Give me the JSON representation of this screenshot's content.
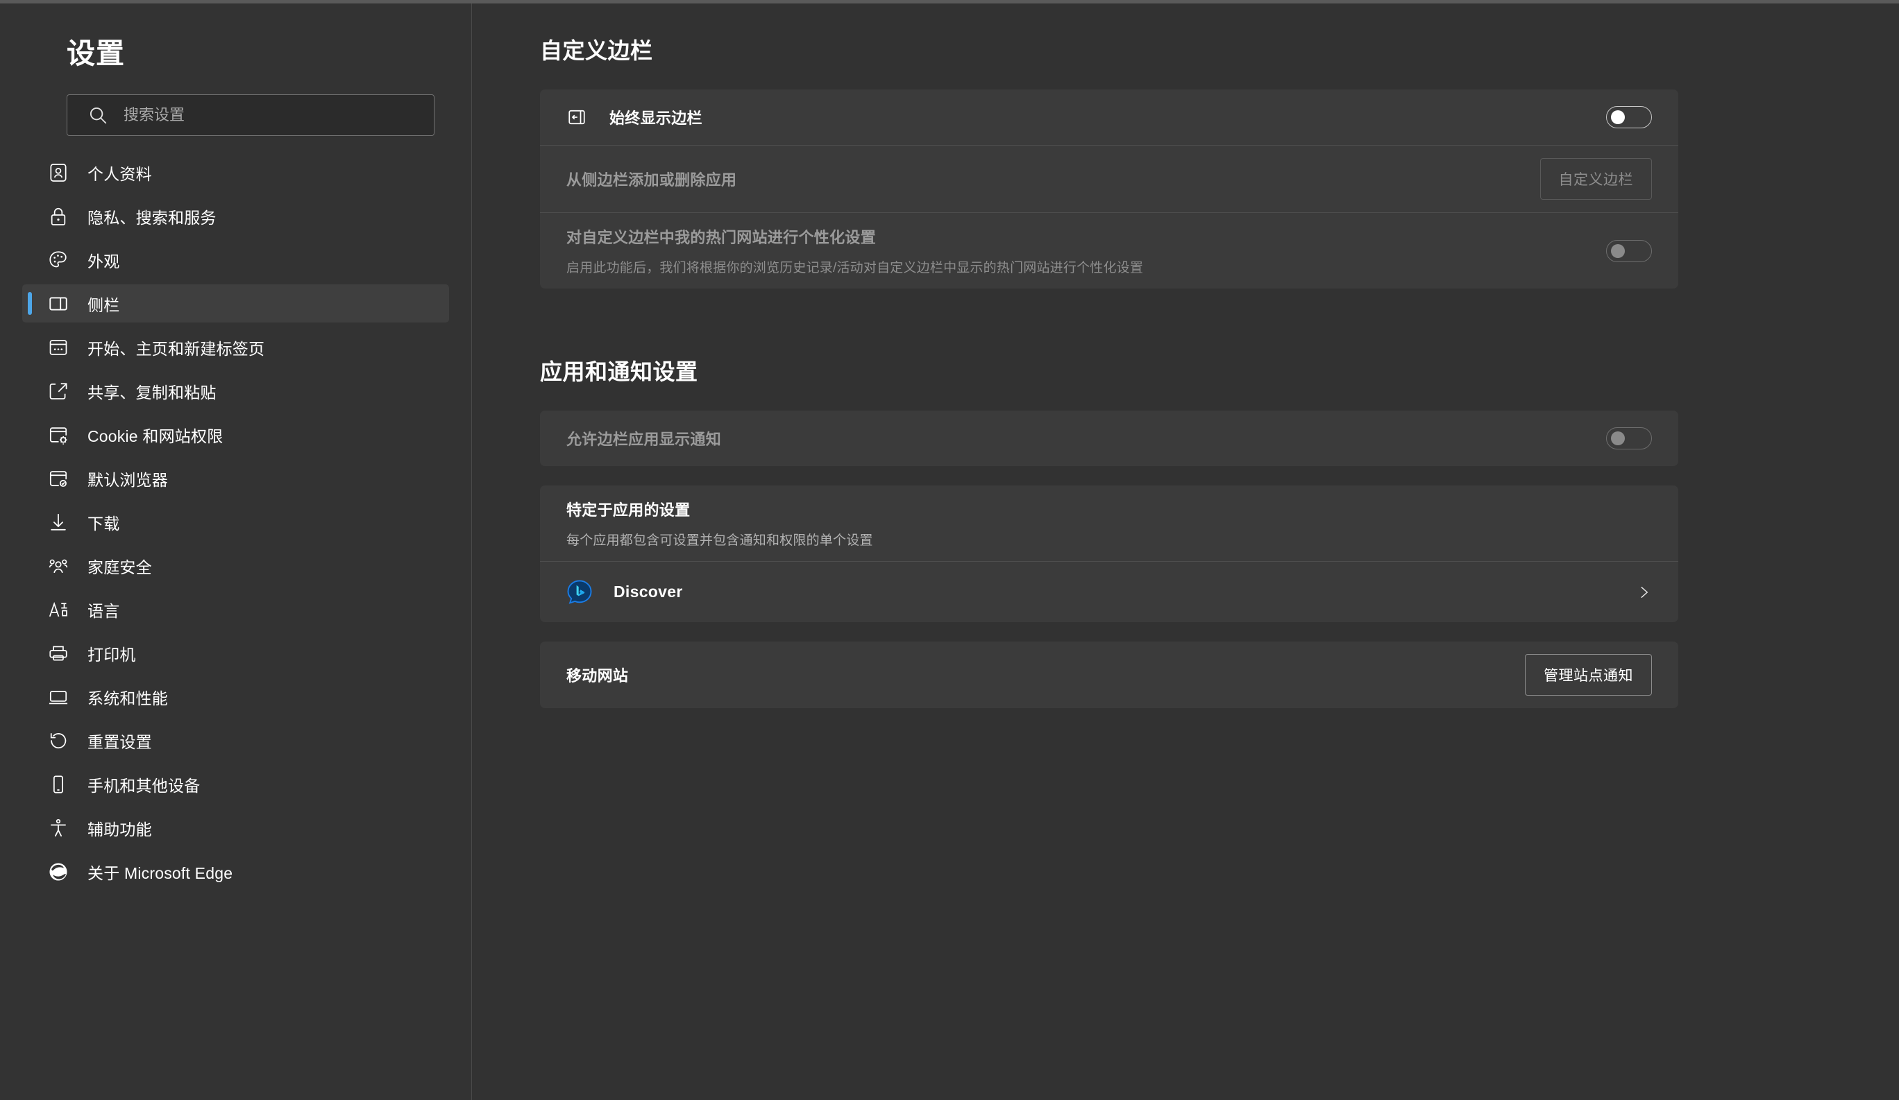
{
  "sidebar": {
    "title": "设置",
    "search": {
      "placeholder": "搜索设置",
      "value": "",
      "icon": "search-icon"
    },
    "items": [
      {
        "label": "个人资料",
        "icon": "profile-icon",
        "selected": false
      },
      {
        "label": "隐私、搜索和服务",
        "icon": "lock-icon",
        "selected": false
      },
      {
        "label": "外观",
        "icon": "palette-icon",
        "selected": false
      },
      {
        "label": "侧栏",
        "icon": "sidebar-panel-icon",
        "selected": true
      },
      {
        "label": "开始、主页和新建标签页",
        "icon": "new-tab-page-icon",
        "selected": false
      },
      {
        "label": "共享、复制和粘贴",
        "icon": "share-icon",
        "selected": false
      },
      {
        "label": "Cookie 和网站权限",
        "icon": "cookie-settings-icon",
        "selected": false
      },
      {
        "label": "默认浏览器",
        "icon": "default-browser-icon",
        "selected": false
      },
      {
        "label": "下载",
        "icon": "download-icon",
        "selected": false
      },
      {
        "label": "家庭安全",
        "icon": "family-icon",
        "selected": false
      },
      {
        "label": "语言",
        "icon": "language-icon",
        "selected": false
      },
      {
        "label": "打印机",
        "icon": "printer-icon",
        "selected": false
      },
      {
        "label": "系统和性能",
        "icon": "system-icon",
        "selected": false
      },
      {
        "label": "重置设置",
        "icon": "reset-icon",
        "selected": false
      },
      {
        "label": "手机和其他设备",
        "icon": "phone-icon",
        "selected": false
      },
      {
        "label": "辅助功能",
        "icon": "accessibility-icon",
        "selected": false
      },
      {
        "label": "关于 Microsoft Edge",
        "icon": "edge-logo-icon",
        "selected": false
      }
    ]
  },
  "main": {
    "section1": {
      "title": "自定义边栏",
      "rows": {
        "always_show": {
          "title": "始终显示边栏",
          "icon": "sidebar-toggle-icon",
          "toggle": {
            "state": "off",
            "disabled": false
          }
        },
        "add_remove_apps": {
          "title": "从侧边栏添加或删除应用",
          "button": {
            "label": "自定义边栏",
            "disabled": true
          }
        },
        "personalize": {
          "title": "对自定义边栏中我的热门网站进行个性化设置",
          "subtitle": "启用此功能后，我们将根据你的浏览历史记录/活动对自定义边栏中显示的热门网站进行个性化设置",
          "toggle": {
            "state": "off",
            "disabled": true
          }
        }
      }
    },
    "section2": {
      "title": "应用和通知设置",
      "rows": {
        "allow_notifications": {
          "title": "允许边栏应用显示通知",
          "toggle": {
            "state": "off",
            "disabled": true
          }
        },
        "app_specific": {
          "title": "特定于应用的设置",
          "subtitle": "每个应用都包含可设置并包含通知和权限的单个设置"
        },
        "discover": {
          "name": "Discover",
          "icon": "bing-discover-icon",
          "chevron": "chevron-right-icon"
        },
        "mobile_sites": {
          "title": "移动网站",
          "button": {
            "label": "管理站点通知",
            "disabled": false
          }
        }
      }
    }
  },
  "colors": {
    "page_bg": "#323232",
    "sidebar_bg": "#333333",
    "card_bg": "#3b3b3b",
    "accent": "#4da6e8",
    "text_primary": "#ffffff",
    "text_secondary": "#b2b2b2",
    "text_disabled": "#8e8e8e"
  }
}
